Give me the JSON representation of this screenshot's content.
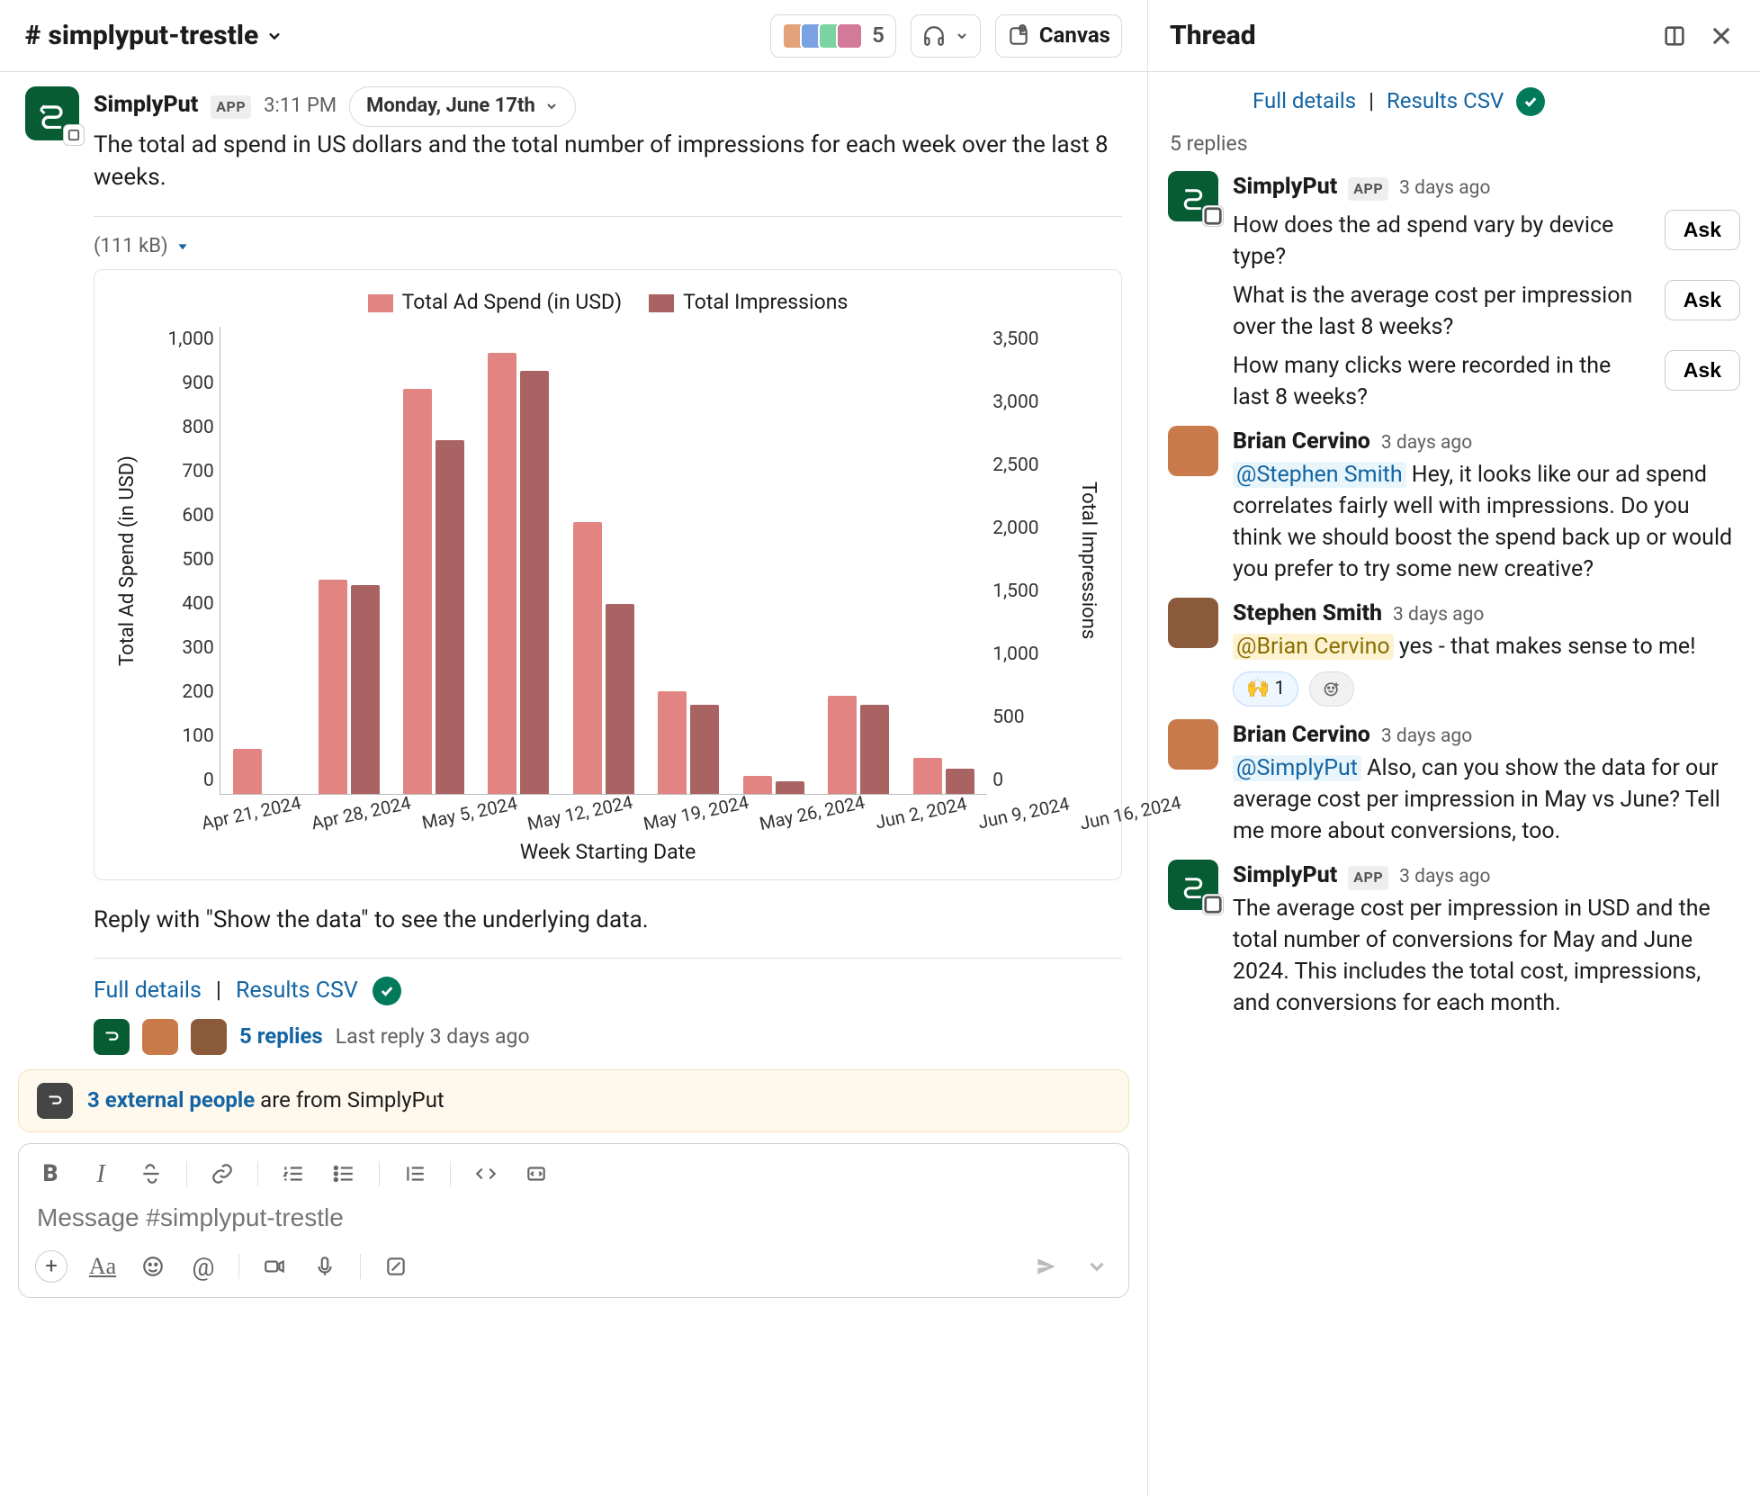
{
  "header": {
    "channel": "simplyput-trestle",
    "member_count": "5",
    "canvas_label": "Canvas"
  },
  "message": {
    "author": "SimplyPut",
    "app_tag": "APP",
    "time": "3:11 PM",
    "date_chip": "Monday, June 17th",
    "body": "The total ad spend in US dollars and the total number of impressions for each week over the last 8 weeks.",
    "file_size": "(111 kB)",
    "instruction": "Reply with \"Show the data\" to see the underlying data.",
    "full_details": "Full details",
    "results_csv": "Results CSV",
    "sep": "|",
    "reply_count": "5 replies",
    "reply_time": "Last reply 3 days ago"
  },
  "chart_data": {
    "type": "bar",
    "legend": [
      "Total Ad Spend (in USD)",
      "Total Impressions"
    ],
    "xlabel": "Week Starting Date",
    "ylabel_left": "Total Ad Spend (in USD)",
    "ylabel_right": "Total Impressions",
    "categories": [
      "Apr 21, 2024",
      "Apr 28, 2024",
      "May 5, 2024",
      "May 12, 2024",
      "May 19, 2024",
      "May 26, 2024",
      "Jun 2, 2024",
      "Jun 9, 2024",
      "Jun 16, 2024"
    ],
    "series": [
      {
        "name": "Total Ad Spend (in USD)",
        "values": [
          100,
          480,
          910,
          990,
          610,
          230,
          40,
          220,
          80
        ],
        "axis": "left",
        "color": "#e28482"
      },
      {
        "name": "Total Impressions",
        "values": [
          0,
          1650,
          2800,
          3350,
          1500,
          700,
          100,
          700,
          200
        ],
        "axis": "right",
        "color": "#aa6363"
      }
    ],
    "y_left_ticks": [
      "1,000",
      "900",
      "800",
      "700",
      "600",
      "500",
      "400",
      "300",
      "200",
      "100",
      "0"
    ],
    "y_right_ticks": [
      "3,500",
      "3,000",
      "2,500",
      "2,000",
      "1,500",
      "1,000",
      "500",
      "0"
    ],
    "ylim_left": [
      0,
      1050
    ],
    "ylim_right": [
      0,
      3700
    ]
  },
  "notice": {
    "link": "3 external people",
    "rest": " are from SimplyPut"
  },
  "composer": {
    "placeholder": "Message #simplyput-trestle"
  },
  "thread": {
    "title": "Thread",
    "top_full_details": "Full details",
    "top_results_csv": "Results CSV",
    "sep": "|",
    "reply_count_label": "5 replies",
    "suggest_author": "SimplyPut",
    "suggest_time": "3 days ago",
    "suggestions": [
      "How does the ad spend vary by device type?",
      "What is the average cost per impression over the last 8 weeks?",
      "How many clicks were recorded in the last 8 weeks?"
    ],
    "ask_label": "Ask",
    "msgs": [
      {
        "author": "Brian Cervino",
        "time": "3 days ago",
        "mention": "@Stephen Smith",
        "text": " Hey, it looks like our ad spend correlates fairly well with impressions. Do you think we should boost the spend back up or would you prefer to try some new creative?"
      },
      {
        "author": "Stephen Smith",
        "time": "3 days ago",
        "mention": "@Brian Cervino",
        "text": " yes - that makes sense to me!",
        "reaction_emoji": "🙌",
        "reaction_count": "1"
      },
      {
        "author": "Brian Cervino",
        "time": "3 days ago",
        "mention": "@SimplyPut",
        "text": " Also, can you show the data for our average cost per impression in May vs June? Tell me more about conversions, too."
      }
    ],
    "bot_reply": {
      "author": "SimplyPut",
      "time": "3 days ago",
      "text": "The average cost per impression in USD and the total number of conversions for May and June 2024. This includes the total cost, impressions, and conversions for each month."
    }
  }
}
